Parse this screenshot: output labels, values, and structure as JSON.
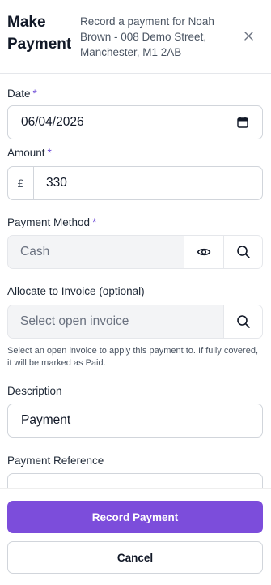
{
  "header": {
    "title": "Make Payment",
    "subtitle": "Record a payment for Noah Brown - 008 Demo Street, Manchester, M1 2AB"
  },
  "form": {
    "date": {
      "label": "Date",
      "required_mark": "*",
      "value": "06/04/2026"
    },
    "amount": {
      "label": "Amount",
      "required_mark": "*",
      "currency": "£",
      "value": "330"
    },
    "payment_method": {
      "label": "Payment Method",
      "required_mark": "*",
      "value": "Cash"
    },
    "invoice": {
      "label": "Allocate to Invoice (optional)",
      "placeholder": "Select open invoice",
      "help": "Select an open invoice to apply this payment to. If fully covered, it will be marked as Paid."
    },
    "description": {
      "label": "Description",
      "value": "Payment"
    },
    "reference": {
      "label": "Payment Reference",
      "value": ""
    }
  },
  "footer": {
    "primary_label": "Record Payment",
    "secondary_label": "Cancel"
  },
  "colors": {
    "accent": "#7c4ddb",
    "required": "#6d4ad6",
    "border": "#d1d5db",
    "muted_bg": "#f3f4f6"
  },
  "icons": [
    "close-icon",
    "calendar-icon",
    "eye-icon",
    "search-icon"
  ]
}
